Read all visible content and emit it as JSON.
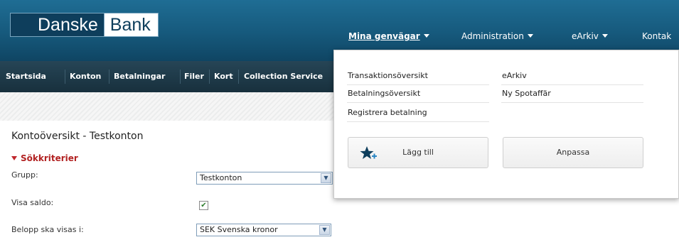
{
  "logo": {
    "part1": "Danske",
    "part2": "Bank"
  },
  "top_nav": {
    "items": [
      {
        "label": "Mina genvägar"
      },
      {
        "label": "Administration"
      },
      {
        "label": "eArkiv"
      },
      {
        "label": "Kontak"
      }
    ]
  },
  "sub_nav": {
    "items": [
      {
        "label": "Startsida"
      },
      {
        "label": "Konton"
      },
      {
        "label": "Betalningar"
      },
      {
        "label": "Filer"
      },
      {
        "label": "Kort"
      },
      {
        "label": "Collection Service"
      }
    ]
  },
  "page": {
    "title": "Kontoöversikt - Testkonton",
    "section_label": "Sökkriterier",
    "rows": [
      {
        "label": "Grupp:",
        "value": "Testkonton"
      },
      {
        "label": "Visa saldo:",
        "checked": true,
        "check_glyph": "✔"
      },
      {
        "label": "Belopp ska visas i:",
        "value": "SEK Svenska kronor"
      }
    ]
  },
  "shortcuts_menu": {
    "left_links": [
      "Transaktionsöversikt",
      "Betalningsöversikt",
      "Registrera betalning"
    ],
    "right_links": [
      "eArkiv",
      "Ny Spotaffär"
    ],
    "add_button": "Lägg till",
    "customize_button": "Anpassa"
  },
  "colors": {
    "header_blue": "#16597c",
    "subnav_dark": "#18303d",
    "section_red": "#b22222",
    "star_blue": "#0e3e5c"
  },
  "icons": {
    "dropdown_arrow": "chevron-down-icon",
    "add_star": "star-plus-icon"
  }
}
